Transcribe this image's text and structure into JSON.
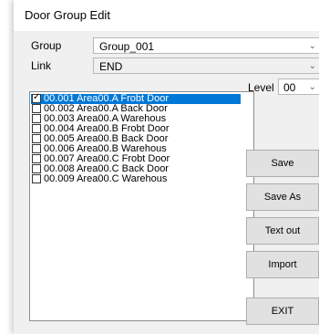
{
  "window": {
    "title": "Door Group Edit"
  },
  "form": {
    "group_label": "Group",
    "group_value": "Group_001",
    "link_label": "Link",
    "link_value": "END",
    "level_label": "Level",
    "level_value": "00"
  },
  "door_list": [
    {
      "label": "00.001 Area00.A Frobt Door",
      "checked": true,
      "selected": true
    },
    {
      "label": "00.002 Area00.A Back Door",
      "checked": false,
      "selected": false
    },
    {
      "label": "00.003 Area00.A Warehous",
      "checked": false,
      "selected": false
    },
    {
      "label": "00.004 Area00.B Frobt Door",
      "checked": false,
      "selected": false
    },
    {
      "label": "00.005 Area00.B Back Door",
      "checked": false,
      "selected": false
    },
    {
      "label": "00.006 Area00.B Warehous",
      "checked": false,
      "selected": false
    },
    {
      "label": "00.007 Area00.C Frobt Door",
      "checked": false,
      "selected": false
    },
    {
      "label": "00.008 Area00.C Back Door",
      "checked": false,
      "selected": false
    },
    {
      "label": "00.009 Area00.C Warehous",
      "checked": false,
      "selected": false
    }
  ],
  "buttons": {
    "save": "Save",
    "save_as": "Save As",
    "text_out": "Text out",
    "import": "Import",
    "exit": "EXIT"
  },
  "icons": {
    "dropdown": "chevron-down-icon",
    "checkbox_mark": "check-icon"
  },
  "colors": {
    "selection": "#0078d7",
    "dialog_bg": "#f0f0f0",
    "button_bg": "#e1e1e1"
  }
}
